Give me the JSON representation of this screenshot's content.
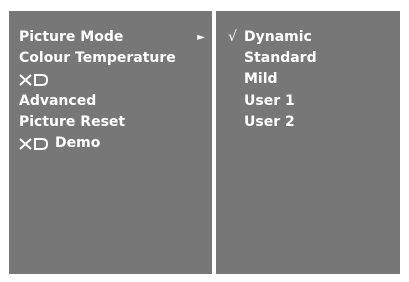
{
  "menu": {
    "items": [
      {
        "label": "Picture Mode",
        "arrow": "►"
      },
      {
        "label": "Colour Temperature"
      },
      {
        "label": ""
      },
      {
        "label": "Advanced"
      },
      {
        "label": "Picture Reset"
      },
      {
        "label": "Demo"
      }
    ]
  },
  "submenu": {
    "checkmark": "√",
    "options": [
      {
        "label": "Dynamic"
      },
      {
        "label": "Standard"
      },
      {
        "label": "Mild"
      },
      {
        "label": "User 1"
      },
      {
        "label": "User 2"
      }
    ]
  },
  "colors": {
    "panel": "#777777",
    "background": "#ffffff",
    "text": "#ffffff"
  },
  "icons": {
    "xd_logo": "xd-logo-icon"
  }
}
